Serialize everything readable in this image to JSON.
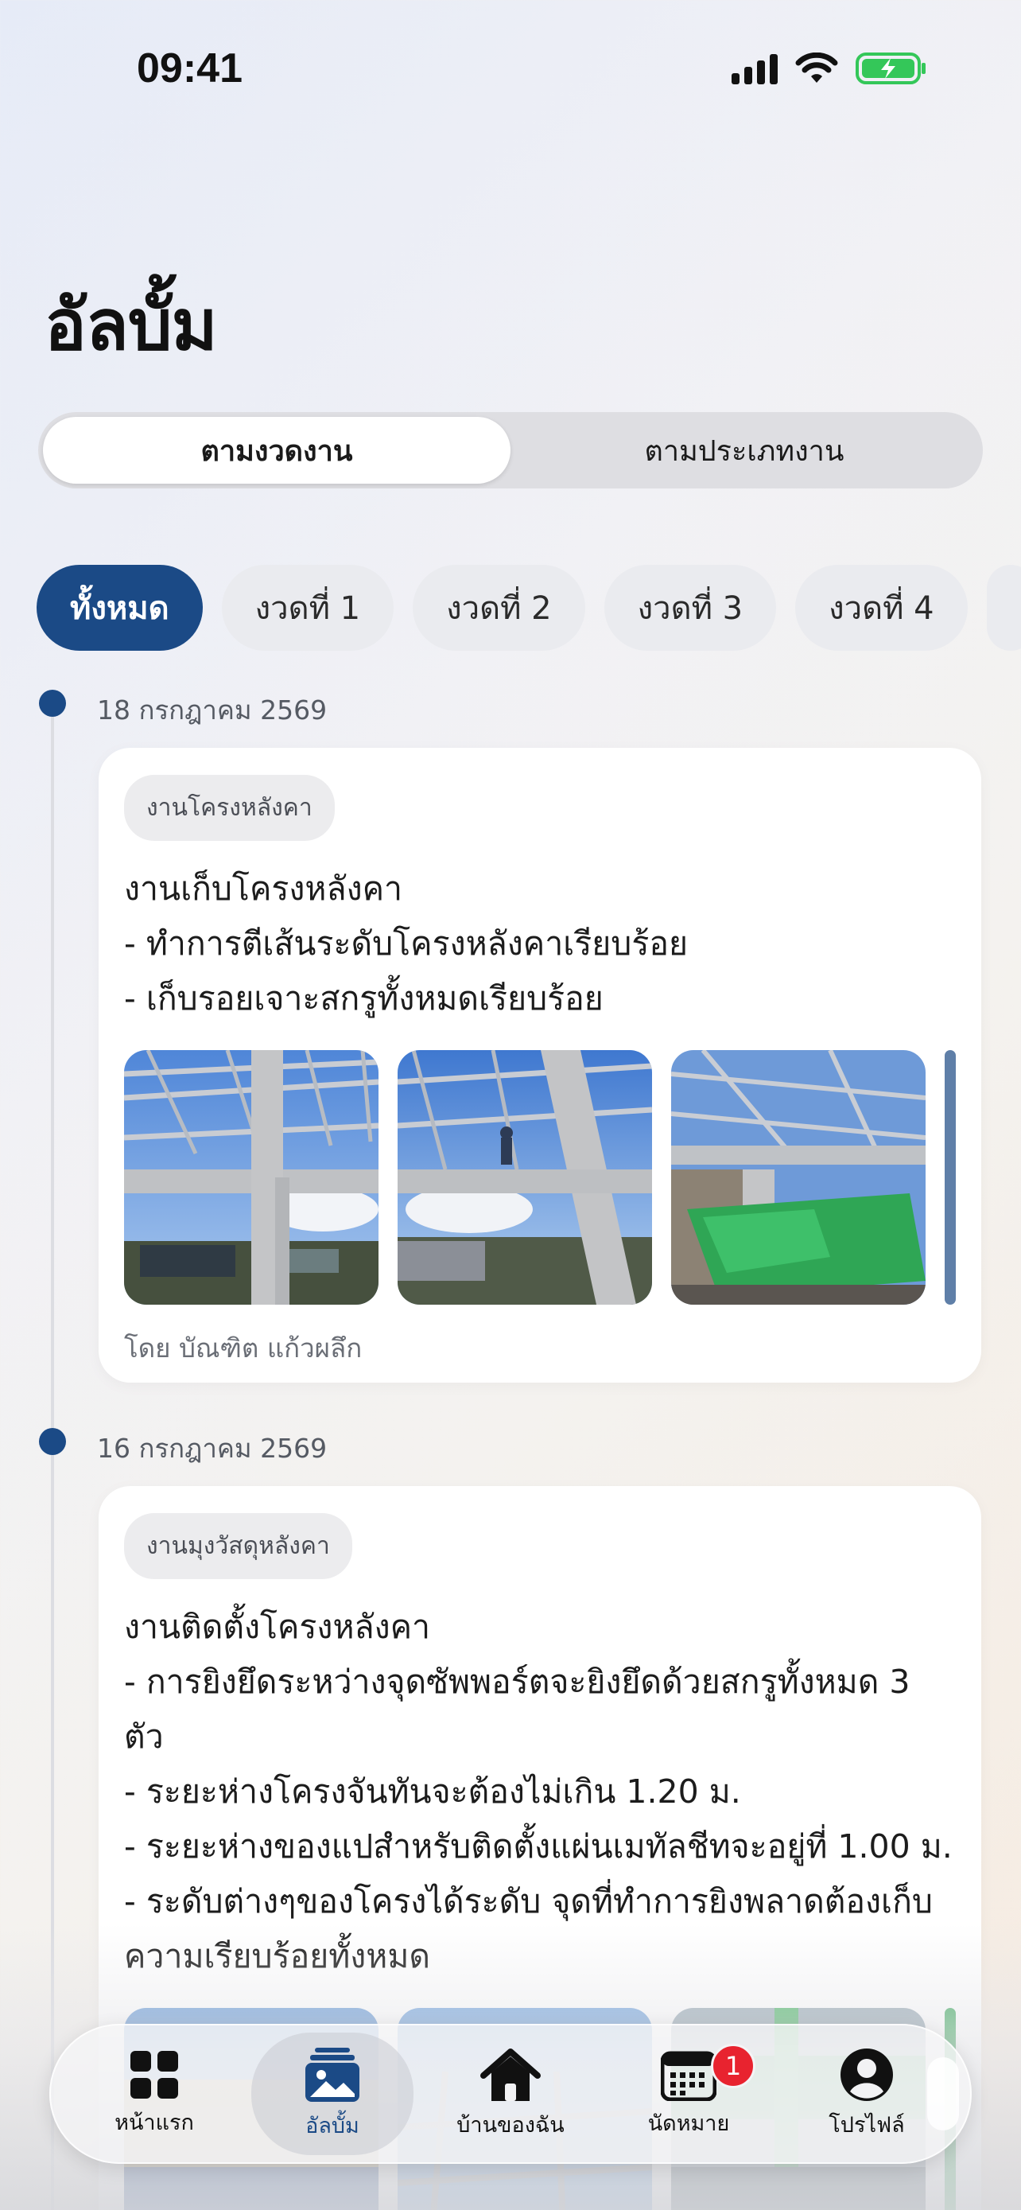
{
  "status_bar": {
    "time": "09:41"
  },
  "header": {
    "title": "อัลบั้ม"
  },
  "segmented": [
    {
      "label": "ตามงวดงาน",
      "selected": true
    },
    {
      "label": "ตามประเภทงาน",
      "selected": false
    }
  ],
  "chips": [
    {
      "label": "ทั้งหมด",
      "selected": true
    },
    {
      "label": "งวดที่ 1",
      "selected": false
    },
    {
      "label": "งวดที่ 2",
      "selected": false
    },
    {
      "label": "งวดที่ 3",
      "selected": false
    },
    {
      "label": "งวดที่ 4",
      "selected": false
    }
  ],
  "entries": [
    {
      "date": "18 กรกฎาคม 2569",
      "tag": "งานโครงหลังคา",
      "lines": [
        "งานเก็บโครงหลังคา",
        "- ทำการตีเส้นระดับโครงหลังคาเรียบร้อย",
        "- เก็บรอยเจาะสกรูทั้งหมดเรียบร้อย"
      ],
      "author": "โดย บัณฑิต แก้วผลึก"
    },
    {
      "date": "16 กรกฎาคม 2569",
      "tag": "งานมุงวัสดุหลังคา",
      "lines": [
        "งานติดตั้งโครงหลังคา",
        "- การยิงยึดระหว่างจุดซัพพอร์ตจะยิงยึดด้วยสกรูทั้งหมด 3 ตัว",
        "- ระยะห่างโครงจันทันจะต้องไม่เกิน 1.20 ม.",
        "- ระยะห่างของแปสำหรับติดตั้งแผ่นเมทัลชีทจะอยู่ที่ 1.00 ม.",
        "- ระดับต่างๆของโครงได้ระดับ จุดที่ทำการยิงพลาดต้องเก็บความเรียบร้อยทั้งหมด"
      ]
    }
  ],
  "tabbar": {
    "tabs": [
      {
        "label": "หน้าแรก",
        "icon": "grid-icon",
        "active": false
      },
      {
        "label": "อัลบั้ม",
        "icon": "photo-album-icon",
        "active": true
      },
      {
        "label": "บ้านของฉัน",
        "icon": "house-icon",
        "active": false
      },
      {
        "label": "นัดหมาย",
        "icon": "calendar-icon",
        "active": false,
        "badge": "1"
      },
      {
        "label": "โปรไฟล์",
        "icon": "profile-icon",
        "active": false
      }
    ]
  },
  "colors": {
    "accent": "#1b4a86",
    "badge": "#e8232f",
    "battery": "#34c759"
  }
}
